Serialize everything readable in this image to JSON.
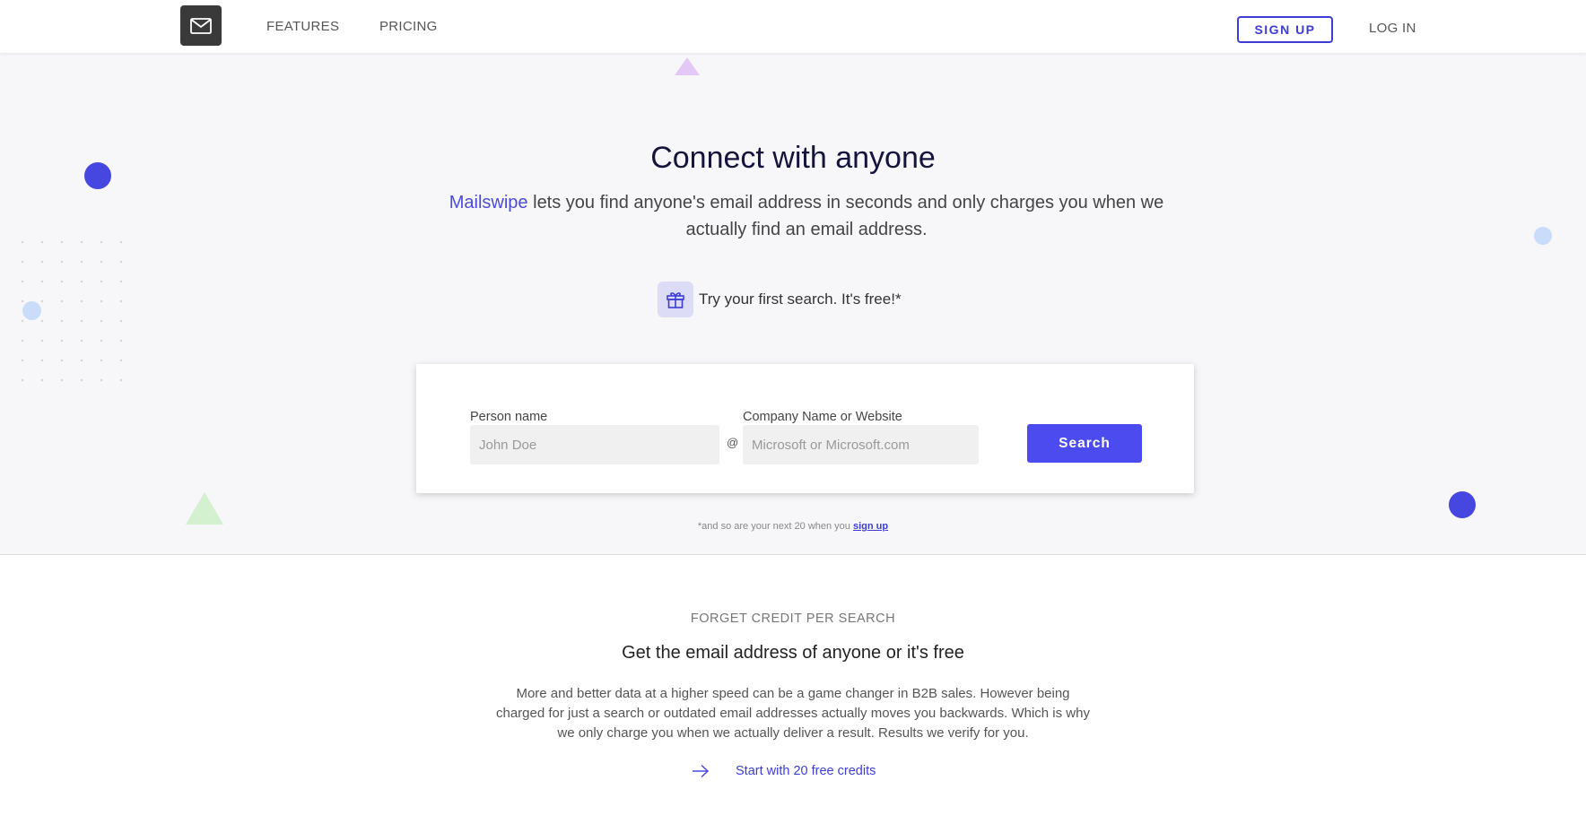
{
  "nav": {
    "logo_icon": "envelope-icon",
    "features": "FEATURES",
    "pricing": "PRICING",
    "signup": "SIGN UP",
    "login": "LOG IN"
  },
  "hero": {
    "title": "Connect with anyone",
    "brand": "Mailswipe",
    "description_rest": " lets you find anyone's email address in seconds and only charges you when we actually find an email address.",
    "try_icon": "gift-icon",
    "try_text": "Try your first search. It's free!*"
  },
  "search": {
    "person_label": "Person name",
    "person_placeholder": "John Doe",
    "at": "@",
    "company_label": "Company Name or Website",
    "company_placeholder": "Microsoft or Microsoft.com",
    "button": "Search"
  },
  "footnote": {
    "text": "*and so are your next 20 when you ",
    "link": "sign up"
  },
  "section": {
    "kicker": "FORGET CREDIT PER SEARCH",
    "title": "Get the email address of anyone or it's free",
    "body": "More and better data at a higher speed can be a game changer in B2B sales. However being charged for just a search or outdated email addresses actually moves you backwards. Which is why we only charge you when we actually deliver a result. Results we verify for you.",
    "cta_icon": "arrow-right-icon",
    "cta": "Start with 20 free credits"
  },
  "colors": {
    "accent": "#4b4bf0",
    "brand": "#3d3dd6",
    "title": "#14143c",
    "hero_bg": "#f7f7fa"
  }
}
